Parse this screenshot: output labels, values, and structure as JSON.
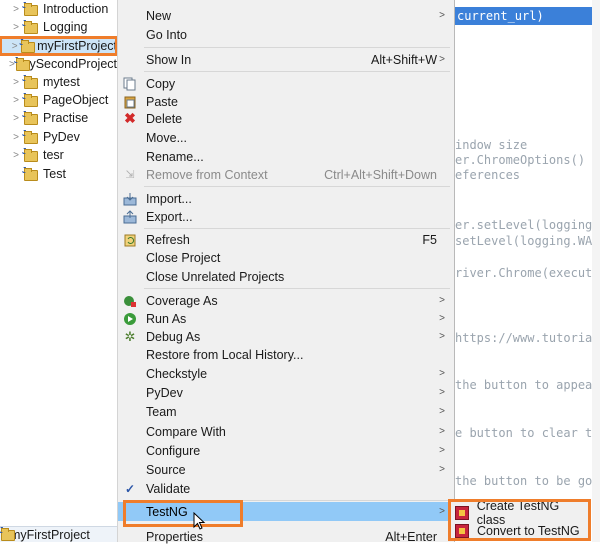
{
  "explorer": {
    "items": [
      {
        "label": "Introduction",
        "selected": false
      },
      {
        "label": "Logging",
        "selected": false
      },
      {
        "label": "myFirstProject",
        "selected": true
      },
      {
        "label": "mySecondProject",
        "selected": false
      },
      {
        "label": "mytest",
        "selected": false
      },
      {
        "label": "PageObject",
        "selected": false
      },
      {
        "label": "Practise",
        "selected": false
      },
      {
        "label": "PyDev",
        "selected": false
      },
      {
        "label": "tesr",
        "selected": false
      },
      {
        "label": "Test",
        "selected": false
      }
    ],
    "status_label": "myFirstProject"
  },
  "editor": {
    "highlighted": "current_url)",
    "lines": [
      "indow size",
      "er.ChromeOptions()",
      "eferences",
      "er.setLevel(logging.W",
      "setLevel(logging.WAR",
      "river.Chrome(executa",
      "https://www.tutorials",
      "the button to appea",
      "e button to clear th",
      "the button to be go"
    ]
  },
  "menu": {
    "items": {
      "new": {
        "label": "New",
        "submenu": true
      },
      "go_into": {
        "label": "Go Into"
      },
      "show_in": {
        "label": "Show In",
        "shortcut": "Alt+Shift+W",
        "submenu": true
      },
      "copy": {
        "label": "Copy",
        "icon": "copy-icon"
      },
      "paste": {
        "label": "Paste",
        "icon": "paste-icon"
      },
      "delete": {
        "label": "Delete",
        "icon": "delete-icon"
      },
      "move": {
        "label": "Move..."
      },
      "rename": {
        "label": "Rename..."
      },
      "remove_context": {
        "label": "Remove from Context",
        "shortcut": "Ctrl+Alt+Shift+Down",
        "disabled": true
      },
      "import": {
        "label": "Import...",
        "icon": "import-icon"
      },
      "export": {
        "label": "Export...",
        "icon": "export-icon"
      },
      "refresh": {
        "label": "Refresh",
        "shortcut": "F5",
        "icon": "refresh-icon"
      },
      "close_project": {
        "label": "Close Project"
      },
      "close_unrelated": {
        "label": "Close Unrelated Projects"
      },
      "coverage_as": {
        "label": "Coverage As",
        "submenu": true,
        "icon": "coverage-icon"
      },
      "run_as": {
        "label": "Run As",
        "submenu": true,
        "icon": "run-icon"
      },
      "debug_as": {
        "label": "Debug As",
        "submenu": true,
        "icon": "debug-icon"
      },
      "restore_history": {
        "label": "Restore from Local History..."
      },
      "checkstyle": {
        "label": "Checkstyle",
        "submenu": true
      },
      "pydev": {
        "label": "PyDev",
        "submenu": true
      },
      "team": {
        "label": "Team",
        "submenu": true
      },
      "compare_with": {
        "label": "Compare With",
        "submenu": true
      },
      "configure": {
        "label": "Configure",
        "submenu": true
      },
      "source": {
        "label": "Source",
        "submenu": true
      },
      "validate": {
        "label": "Validate",
        "icon": "validate-checkbox-icon"
      },
      "testng": {
        "label": "TestNG",
        "submenu": true,
        "active": true
      },
      "properties": {
        "label": "Properties",
        "shortcut": "Alt+Enter"
      }
    }
  },
  "submenu": {
    "items": [
      {
        "label": "Create TestNG class",
        "icon": "testng-icon"
      },
      {
        "label": "Convert to TestNG",
        "icon": "testng-icon"
      }
    ]
  },
  "colors": {
    "highlight_box": "#ef7d2b",
    "menu_bg": "#f0f0f0",
    "active_item": "#91c9f7",
    "editor_selection": "#3b80d9"
  }
}
